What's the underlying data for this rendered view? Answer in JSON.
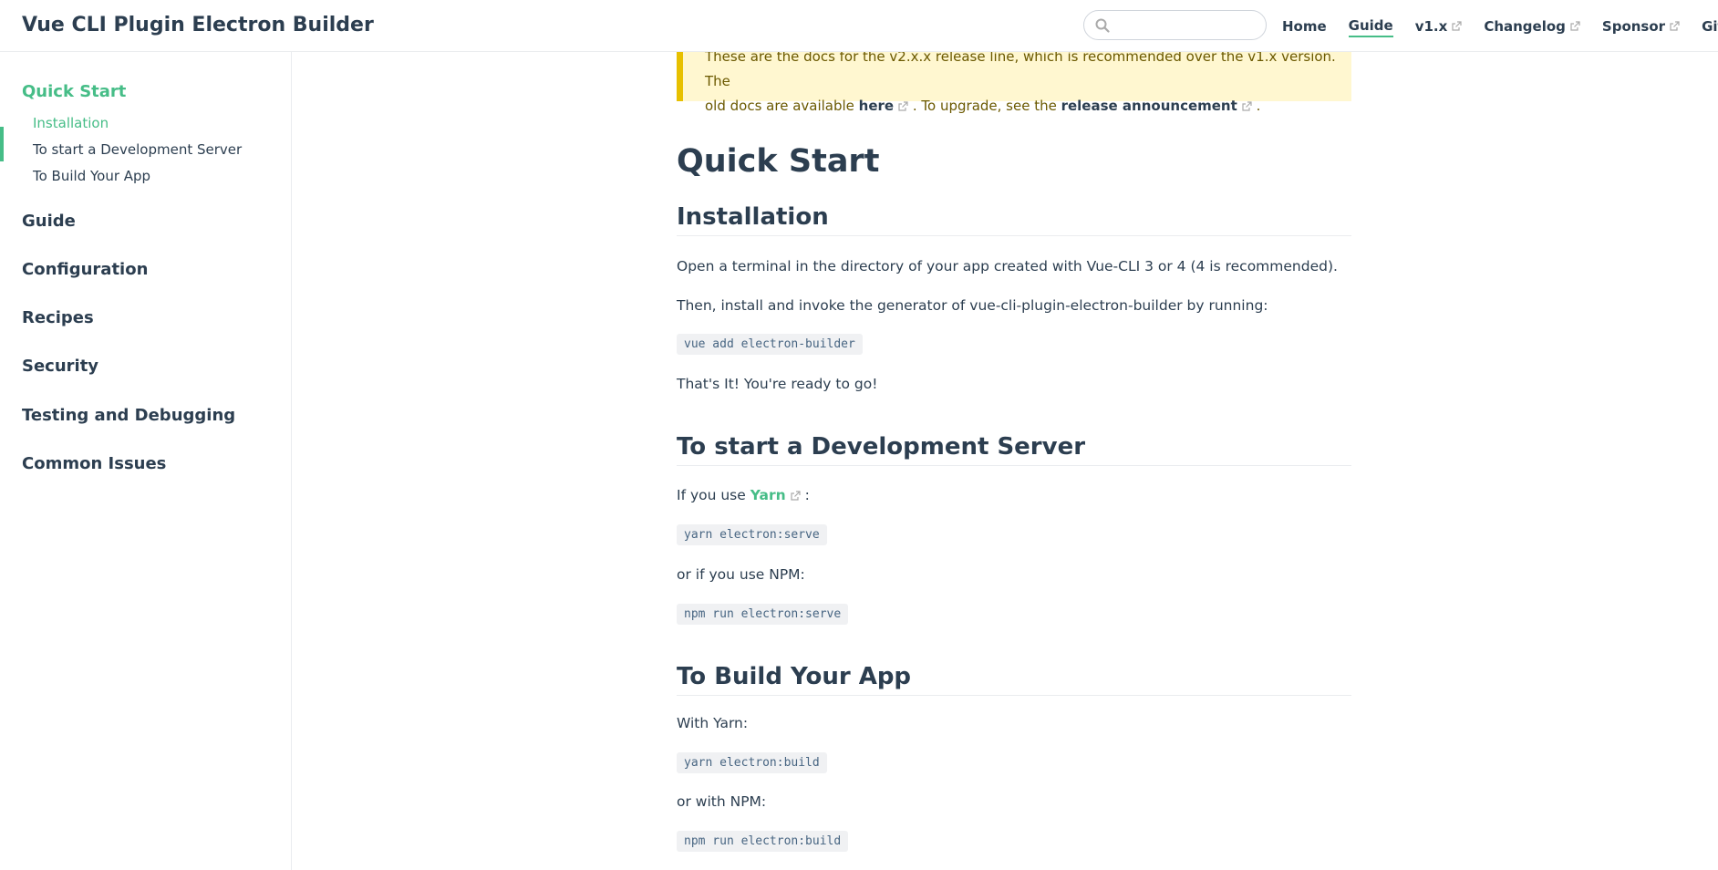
{
  "navbar": {
    "site_name": "Vue CLI Plugin Electron Builder",
    "search": {
      "value": "",
      "placeholder": ""
    },
    "links": [
      {
        "label": "Home",
        "active": false,
        "external": false
      },
      {
        "label": "Guide",
        "active": true,
        "external": false
      },
      {
        "label": "v1.x",
        "active": false,
        "external": true
      },
      {
        "label": "Changelog",
        "active": false,
        "external": true
      },
      {
        "label": "Sponsor",
        "active": false,
        "external": true
      },
      {
        "label": "GitHub",
        "active": false,
        "external": true
      }
    ]
  },
  "sidebar": {
    "groups": [
      {
        "label": "Quick Start",
        "active": true,
        "children": [
          {
            "label": "Installation",
            "active": true
          },
          {
            "label": "To start a Development Server",
            "active": false
          },
          {
            "label": "To Build Your App",
            "active": false
          }
        ]
      },
      {
        "label": "Guide"
      },
      {
        "label": "Configuration"
      },
      {
        "label": "Recipes"
      },
      {
        "label": "Security"
      },
      {
        "label": "Testing and Debugging"
      },
      {
        "label": "Common Issues"
      }
    ]
  },
  "tip": {
    "line1": "These are the docs for the v2.x.x release line, which is recommended over the v1.x version. The",
    "line2_prefix": "old docs are available ",
    "here_link": "here",
    "line2_middle": " . To upgrade, see the ",
    "announcement_link": "release announcement",
    "line2_suffix": " ."
  },
  "content": {
    "title": "Quick Start",
    "installation": {
      "heading": "Installation",
      "p1": "Open a terminal in the directory of your app created with Vue-CLI 3 or 4 (4 is recommended).",
      "p2": "Then, install and invoke the generator of vue-cli-plugin-electron-builder by running:",
      "code": "vue add electron-builder",
      "p3": "That's It! You're ready to go!"
    },
    "dev_server": {
      "heading": "To start a Development Server",
      "p1_prefix": "If you use ",
      "yarn_link": "Yarn",
      "p1_suffix": " :",
      "code_yarn": "yarn electron:serve",
      "p2": "or if you use NPM:",
      "code_npm": "npm run electron:serve"
    },
    "build": {
      "heading": "To Build Your App",
      "p1": "With Yarn:",
      "code_yarn": "yarn electron:build",
      "p2": "or with NPM:",
      "code_npm": "npm run electron:build"
    }
  },
  "colors": {
    "accent": "#46bd87",
    "text": "#2c3e50",
    "tip_bg": "#fff7d0",
    "tip_border": "#e7c000"
  }
}
